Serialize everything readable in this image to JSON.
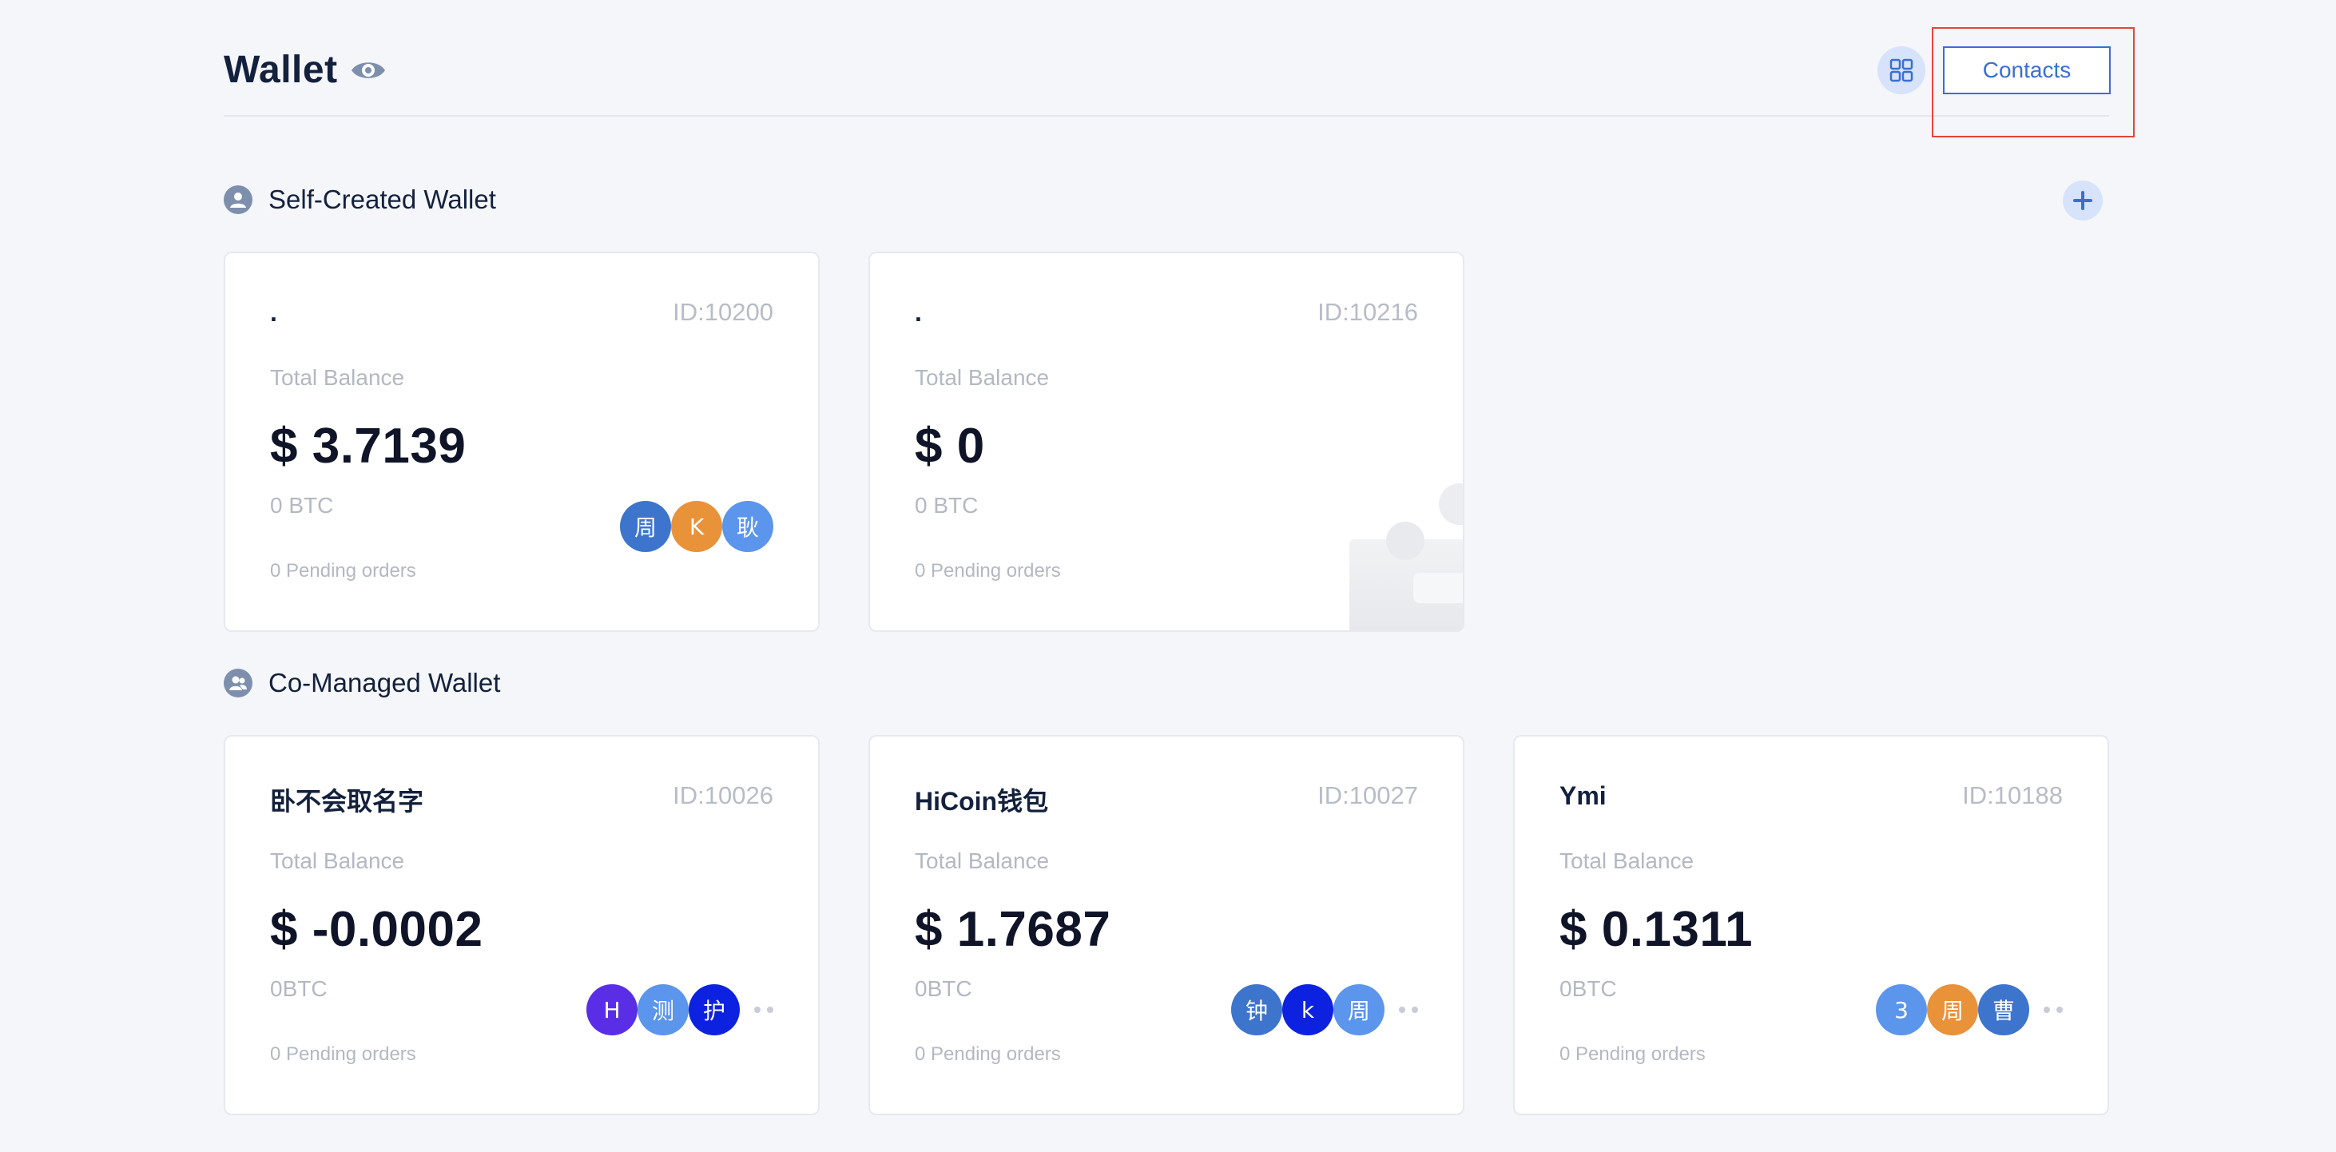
{
  "header": {
    "title": "Wallet",
    "contacts_label": "Contacts"
  },
  "sections": {
    "self_created": {
      "title": "Self-Created Wallet",
      "cards": [
        {
          "name": ".",
          "id": "ID:10200",
          "balance_label": "Total Balance",
          "balance": "$ 3.7139",
          "btc": "0 BTC",
          "pending": "0 Pending orders",
          "avatars": [
            {
              "text": "周",
              "color": "#3d74cc"
            },
            {
              "text": "K",
              "color": "#e8923a"
            },
            {
              "text": "耿",
              "color": "#5b95ec"
            }
          ]
        },
        {
          "name": ".",
          "id": "ID:10216",
          "balance_label": "Total Balance",
          "balance": "$ 0",
          "btc": "0 BTC",
          "pending": "0 Pending orders",
          "avatars": []
        }
      ]
    },
    "co_managed": {
      "title": "Co-Managed Wallet",
      "cards": [
        {
          "name": "卧不会取名字",
          "id": "ID:10026",
          "balance_label": "Total Balance",
          "balance": "$ -0.0002",
          "btc": "0BTC",
          "pending": "0 Pending orders",
          "avatars": [
            {
              "text": "H",
              "color": "#5a2ee6"
            },
            {
              "text": "测",
              "color": "#5b95ec"
            },
            {
              "text": "护",
              "color": "#0d22e0"
            }
          ]
        },
        {
          "name": "HiCoin钱包",
          "id": "ID:10027",
          "balance_label": "Total Balance",
          "balance": "$ 1.7687",
          "btc": "0BTC",
          "pending": "0 Pending orders",
          "avatars": [
            {
              "text": "钟",
              "color": "#3d74cc"
            },
            {
              "text": "k",
              "color": "#0d22e0"
            },
            {
              "text": "周",
              "color": "#5b95ec"
            }
          ]
        },
        {
          "name": "Ymi",
          "id": "ID:10188",
          "balance_label": "Total Balance",
          "balance": "$ 0.1311",
          "btc": "0BTC",
          "pending": "0 Pending orders",
          "avatars": [
            {
              "text": "3",
              "color": "#5b95ec"
            },
            {
              "text": "周",
              "color": "#e8923a"
            },
            {
              "text": "曹",
              "color": "#3d74cc"
            }
          ]
        }
      ]
    }
  },
  "icons": {
    "eye": "eye-icon",
    "grid": "grid-view-icon",
    "add": "plus-icon",
    "person": "user-icon",
    "group": "users-icon"
  },
  "colors": {
    "accent": "#3a6fd0",
    "highlight": "#e0473a"
  }
}
